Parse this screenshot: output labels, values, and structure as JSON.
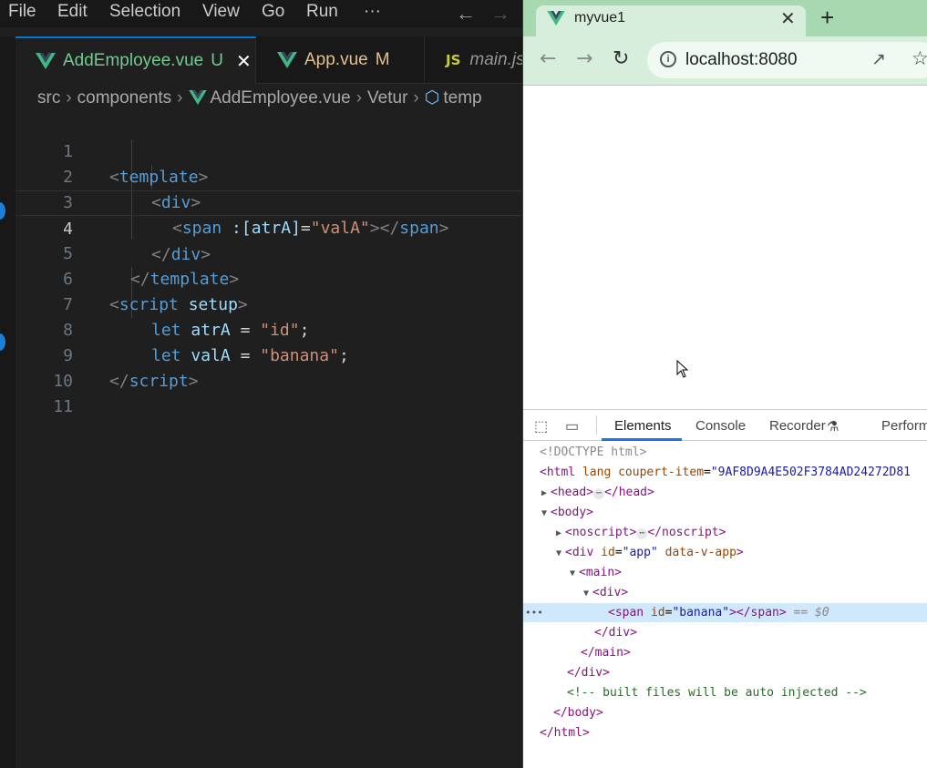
{
  "vscode": {
    "menu": [
      "File",
      "Edit",
      "Selection",
      "View",
      "Go",
      "Run",
      "···"
    ],
    "tabs": [
      {
        "label": "AddEmployee.vue",
        "flag": "U",
        "close": "✕"
      },
      {
        "label": "App.vue",
        "flag": "M"
      },
      {
        "badge": "JS",
        "label": "main.js"
      }
    ],
    "breadcrumb": [
      "src",
      "components",
      "AddEmployee.vue",
      "Vetur",
      "temp"
    ],
    "current_line": 4,
    "code_lines": [
      {
        "n": "1"
      },
      {
        "n": "2"
      },
      {
        "n": "3"
      },
      {
        "n": "4"
      },
      {
        "n": "5"
      },
      {
        "n": "6"
      },
      {
        "n": "7"
      },
      {
        "n": "8"
      },
      {
        "n": "9"
      },
      {
        "n": "10"
      },
      {
        "n": "11"
      }
    ],
    "code": {
      "l1_tag": "template",
      "l2_tag": "div",
      "l3_tag": "span",
      "l3_attr": ":[atrA]",
      "l3_val": "\"valA\"",
      "l3_close": "span",
      "l4_tag": "div",
      "l5_tag": "template",
      "l6_tag": "script",
      "l6_attr": "setup",
      "l7_kw": "let",
      "l7_var": "atrA",
      "l7_val": "\"id\"",
      "l8_kw": "let",
      "l8_var": "valA",
      "l8_val": "\"banana\"",
      "l9_tag": "script"
    }
  },
  "browser": {
    "tab_title": "myvue1",
    "tab_close": "✕",
    "new_tab": "+",
    "url": "localhost:8080",
    "devtools": {
      "tabs": [
        "Elements",
        "Console",
        "Recorder",
        "Perform"
      ],
      "active_tab": "Elements",
      "tree": {
        "doctype": "<!DOCTYPE html>",
        "html_tag": "html",
        "html_attr_lang": "lang",
        "html_attr_cp": "coupert-item",
        "html_attr_cp_val": "\"9AF8D9A4E502F3784AD24272D81",
        "head": "head",
        "body": "body",
        "noscript": "noscript",
        "div_app_id": "\"app\"",
        "div_app_data": "data-v-app",
        "main": "main",
        "div": "div",
        "span_id": "\"banana\"",
        "eq_ref": "== $0",
        "comment": "<!-- built files will be auto injected -->"
      }
    }
  }
}
